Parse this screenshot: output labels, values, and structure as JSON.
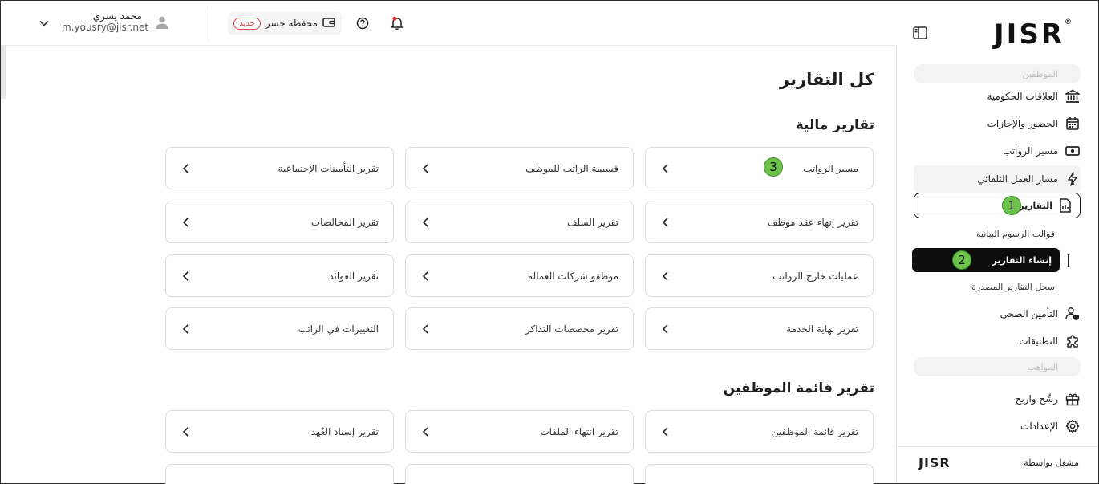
{
  "sidebar": {
    "logo": "JISR",
    "nav": [
      {
        "label": "الموظفين",
        "faded": true
      },
      {
        "label": "العلاقات الحكومية"
      },
      {
        "label": "الحضور والإجازات"
      },
      {
        "label": "مسير الرواتب"
      },
      {
        "label": "مسار العمل التلقائي"
      },
      {
        "label": "التقارير"
      },
      {
        "label": "قوالب الرسوم البيانية"
      },
      {
        "label": "إنشاء التقارير"
      },
      {
        "label": "سجل التقارير المصدرة"
      },
      {
        "label": "التأمين الصحي"
      },
      {
        "label": "التطبيقات"
      },
      {
        "label": "المواهب",
        "faded": true
      },
      {
        "label": "رشّح واربح"
      },
      {
        "label": "الإعدادات"
      }
    ],
    "footer_label": "مشغل بواسطة",
    "footer_logo": "JISR"
  },
  "annotations": {
    "step1": "1",
    "step2": "2",
    "step3": "3"
  },
  "topbar": {
    "user_name": "محمد يسري",
    "user_email": "m.yousry@jisr.net",
    "wallet_label": "محفظة جسر",
    "new_badge": "جديد"
  },
  "main": {
    "title": "كل التقارير",
    "financial": {
      "title": "تقارير مالية",
      "cards": [
        "مسير الرواتب",
        "قسيمة الراتب للموظف",
        "تقرير التأمينات الإجتماعية",
        "تقرير إنهاء عقد موظف",
        "تقرير السلف",
        "تقرير المخالصات",
        "عمليات خارج الرواتب",
        "موظفو شركات العمالة",
        "تقرير العوائد",
        "تقرير نهاية الخدمة",
        "تقرير مخصصات التذاكر",
        "التغييرات في الراتب"
      ]
    },
    "employees": {
      "title": "تقرير قائمة الموظفين",
      "cards": [
        "تقرير قائمة الموظفين",
        "تقرير انتهاء الملفات",
        "تقرير إسناد العُهد"
      ]
    }
  },
  "colors": {
    "annotation_green": "#6cc24a",
    "badge_red": "#d64545",
    "active_dark": "#0d0d0d"
  }
}
